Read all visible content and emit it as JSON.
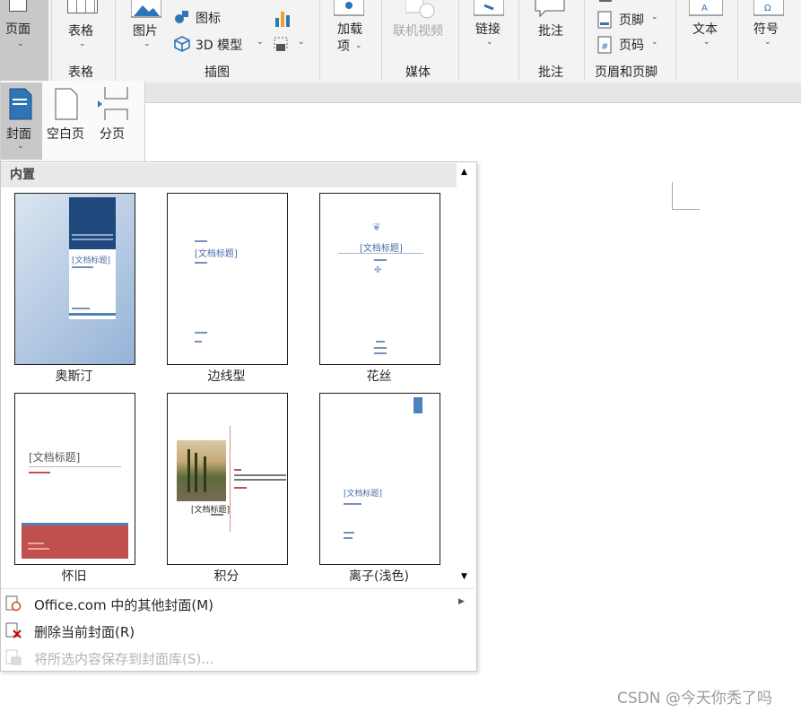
{
  "ribbon": {
    "page_btn": "页面",
    "table_btn": "表格",
    "table_group": "表格",
    "picture_btn": "图片",
    "icons_btn": "图标",
    "model3d_btn": "3D 模型",
    "illustrations_group": "插图",
    "addins_btn_line1": "加载",
    "addins_btn_line2": "项",
    "online_video_btn": "联机视频",
    "media_group": "媒体",
    "link_btn": "链接",
    "comment_btn": "批注",
    "comment_group": "批注",
    "footer_btn": "页脚",
    "page_number_btn": "页码",
    "header_footer_group": "页眉和页脚",
    "text_btn": "文本",
    "symbol_btn": "符号"
  },
  "page_menu": {
    "cover_btn": "封面",
    "blank_btn": "空白页",
    "break_btn": "分页"
  },
  "gallery": {
    "section_title": "内置",
    "placeholder_title": "[文档标题]",
    "covers": [
      {
        "name": "奥斯汀"
      },
      {
        "name": "边线型"
      },
      {
        "name": "花丝"
      },
      {
        "name": "怀旧"
      },
      {
        "name": "积分"
      },
      {
        "name": "离子(浅色)"
      }
    ]
  },
  "menu": {
    "more_covers": "Office.com 中的其他封面(M)",
    "remove_cover": "删除当前封面(R)",
    "save_selection": "将所选内容保存到封面库(S)..."
  },
  "watermark": "CSDN @今天你秃了吗",
  "colors": {
    "austin_blue": "#1f497d",
    "retro_red": "#c0504d",
    "ion_blue": "#4f81bd"
  }
}
